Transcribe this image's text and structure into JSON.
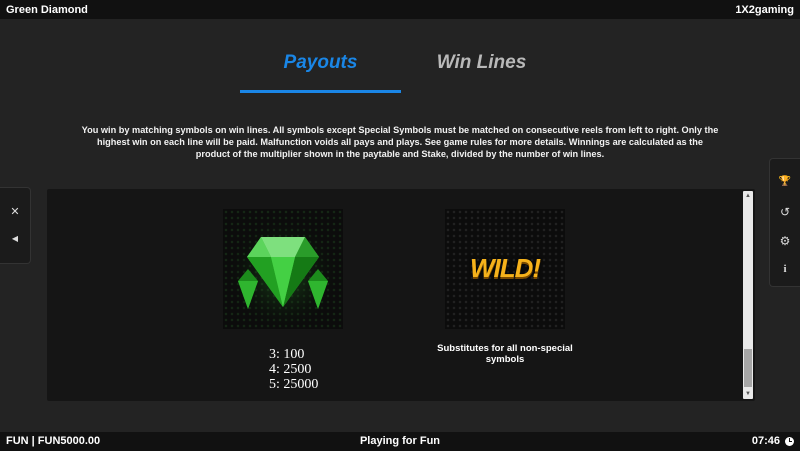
{
  "header": {
    "game_title": "Green Diamond",
    "provider": "1X2gaming"
  },
  "tabs": [
    {
      "label": "Payouts",
      "active": true
    },
    {
      "label": "Win Lines",
      "active": false
    }
  ],
  "description": "You win by matching symbols on win lines. All symbols except Special Symbols must be matched on consecutive reels from left to right. Only the highest win on each line will be paid. Malfunction voids all pays and plays. See game rules for more details. Winnings are calculated as the product of the multiplier shown in the paytable and Stake, divided by the number of win lines.",
  "symbols": {
    "gem": {
      "icon": "green-diamond-icon",
      "payouts": [
        "3: 100",
        "4: 2500",
        "5: 25000"
      ]
    },
    "wild": {
      "label": "WILD!",
      "description": "Substitutes for all non-special symbols"
    }
  },
  "left_panel": {
    "close_icon": "✕",
    "back_icon": "◀"
  },
  "right_panel": {
    "icons": [
      "trophy-icon",
      "history-icon",
      "gear-icon",
      "info-icon"
    ],
    "glyphs": [
      "🏆",
      "↺",
      "⚙",
      "i"
    ]
  },
  "footer": {
    "balance": "FUN | FUN5000.00",
    "status": "Playing for Fun",
    "time": "07:46"
  },
  "colors": {
    "accent": "#1a86e6",
    "wild": "#f6b21b",
    "gem": "#3fbf3f"
  }
}
